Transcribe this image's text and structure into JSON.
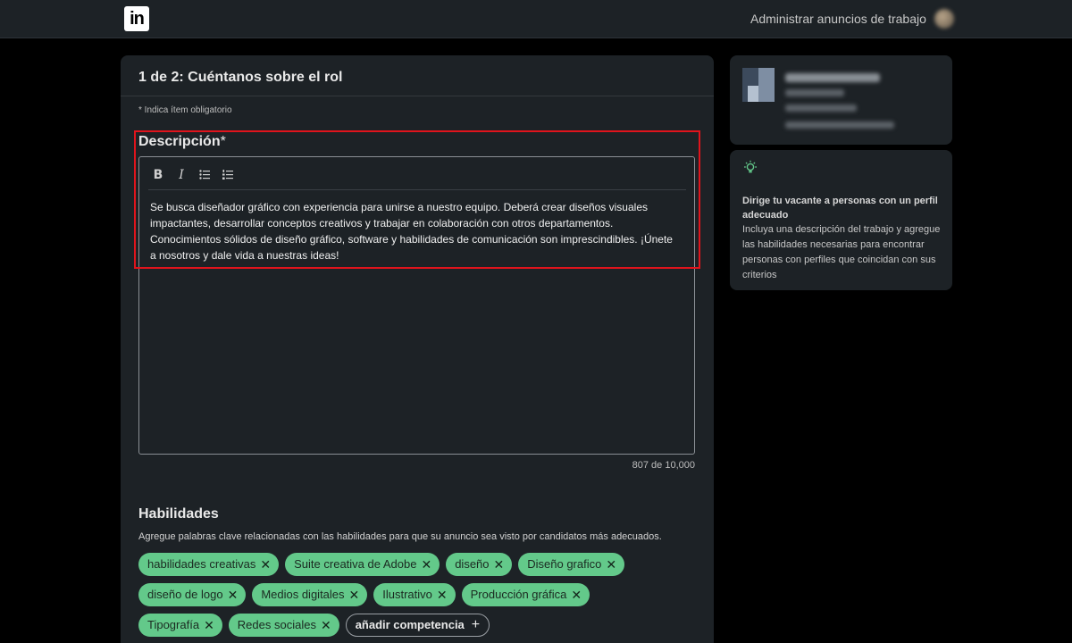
{
  "nav": {
    "logo_text": "in",
    "manage_jobs": "Administrar anuncios de trabajo"
  },
  "form": {
    "step_title": "1 de 2: Cuéntanos sobre el rol",
    "required_note": "* Indica ítem obligatorio",
    "description": {
      "label": "Descripción",
      "required_mark": "*",
      "toolbar": {
        "bold": "B",
        "italic": "I"
      },
      "text": "Se busca diseñador gráfico con experiencia para unirse a nuestro equipo. Deberá crear diseños visuales impactantes, desarrollar conceptos creativos y trabajar en colaboración con otros departamentos. Conocimientos sólidos de diseño gráfico, software y habilidades de comunicación son imprescindibles. ¡Únete a nosotros y dale vida a nuestras ideas!",
      "char_count": "807 de 10,000"
    },
    "skills": {
      "title": "Habilidades",
      "description": "Agregue palabras clave relacionadas con las habilidades para que su anuncio sea visto por candidatos más adecuados.",
      "chips": [
        "habilidades creativas",
        "Suite creativa de Adobe",
        "diseño",
        "Diseño grafico",
        "diseño de logo",
        "Medios digitales",
        "Ilustrativo",
        "Producción gráfica",
        "Tipografía",
        "Redes sociales"
      ],
      "remove_symbol": "✕",
      "add_label": "añadir competencia",
      "add_symbol": "+"
    }
  },
  "tip": {
    "icon": "lightbulb-icon",
    "title": "Dirige tu vacante a personas con un perfil adecuado",
    "body": "Incluya una descripción del trabajo y agregue las habilidades necesarias para encontrar personas con perfiles que coincidan con sus criterios"
  },
  "colors": {
    "background": "#000000",
    "card": "#1d2226",
    "chip": "#63c98a",
    "highlight": "#e0141c",
    "tip_icon": "#63c98a"
  }
}
